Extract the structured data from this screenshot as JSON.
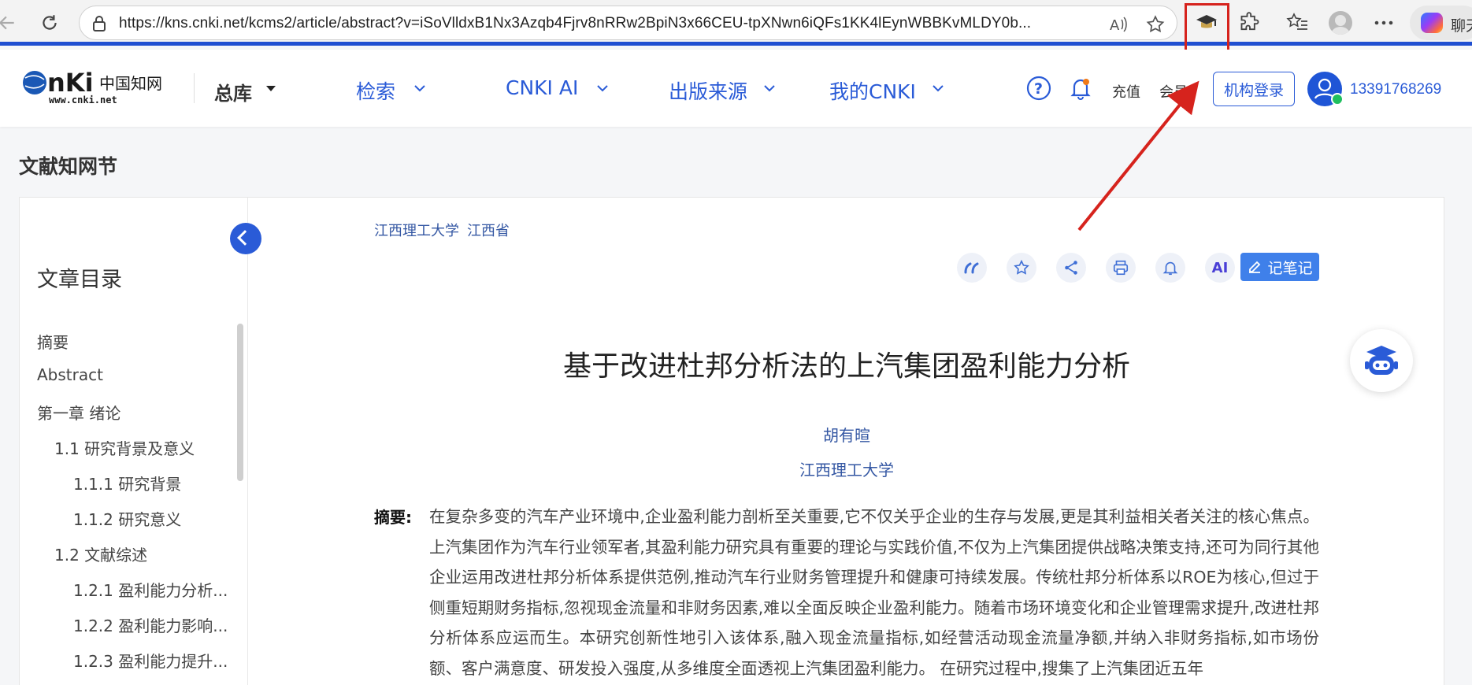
{
  "browser": {
    "url": "https://kns.cnki.net/kcms2/article/abstract?v=iSoVlldxB1Nx3Azqb4Fjrv8nRRw2BpiN3x66CEU-tpXNwn6iQFs1KK4lEynWBBKvMLDY0b...",
    "copilot_label": "聊天"
  },
  "header": {
    "logo_text": "CNKi中国知网",
    "logo_sub": "www.cnki.net",
    "library": "总库",
    "nav": [
      "检索",
      "CNKI AI",
      "出版来源",
      "我的CNKI"
    ],
    "recharge": "充值",
    "member": "会员",
    "org_login": "机构登录",
    "user_phone": "13391768269"
  },
  "page": {
    "title": "文献知网节"
  },
  "sidebar": {
    "title": "文章目录",
    "items": [
      {
        "label": "摘要",
        "level": 0
      },
      {
        "label": "Abstract",
        "level": 0
      },
      {
        "label": "第一章 绪论",
        "level": 0
      },
      {
        "label": "1.1 研究背景及意义",
        "level": 1
      },
      {
        "label": "1.1.1 研究背景",
        "level": 2
      },
      {
        "label": "1.1.2 研究意义",
        "level": 2
      },
      {
        "label": "1.2 文献综述",
        "level": 1
      },
      {
        "label": "1.2.1 盈利能力分析...",
        "level": 2
      },
      {
        "label": "1.2.2 盈利能力影响...",
        "level": 2
      },
      {
        "label": "1.2.3 盈利能力提升...",
        "level": 2
      }
    ]
  },
  "article": {
    "affiliations": [
      "江西理工大学",
      "江西省"
    ],
    "title": "基于改进杜邦分析法的上汽集团盈利能力分析",
    "author": "胡有暄",
    "institution": "江西理工大学",
    "abstract_label": "摘要:",
    "abstract": "在复杂多变的汽车产业环境中,企业盈利能力剖析至关重要,它不仅关乎企业的生存与发展,更是其利益相关者关注的核心焦点。上汽集团作为汽车行业领军者,其盈利能力研究具有重要的理论与实践价值,不仅为上汽集团提供战略决策支持,还可为同行其他企业运用改进杜邦分析体系提供范例,推动汽车行业财务管理提升和健康可持续发展。传统杜邦分析体系以ROE为核心,但过于侧重短期财务指标,忽视现金流量和非财务因素,难以全面反映企业盈利能力。随着市场环境变化和企业管理需求提升,改进杜邦分析体系应运而生。本研究创新性地引入该体系,融入现金流量指标,如经营活动现金流量净额,并纳入非财务指标,如市场份额、客户满意度、研发投入强度,从多维度全面透视上汽集团盈利能力。 在研究过程中,搜集了上汽集团近五年"
  },
  "toolbar": {
    "note_label": "记笔记",
    "ai_label": "AI"
  },
  "colors": {
    "accent": "#2a5bd7",
    "highlight": "#d6231d"
  }
}
